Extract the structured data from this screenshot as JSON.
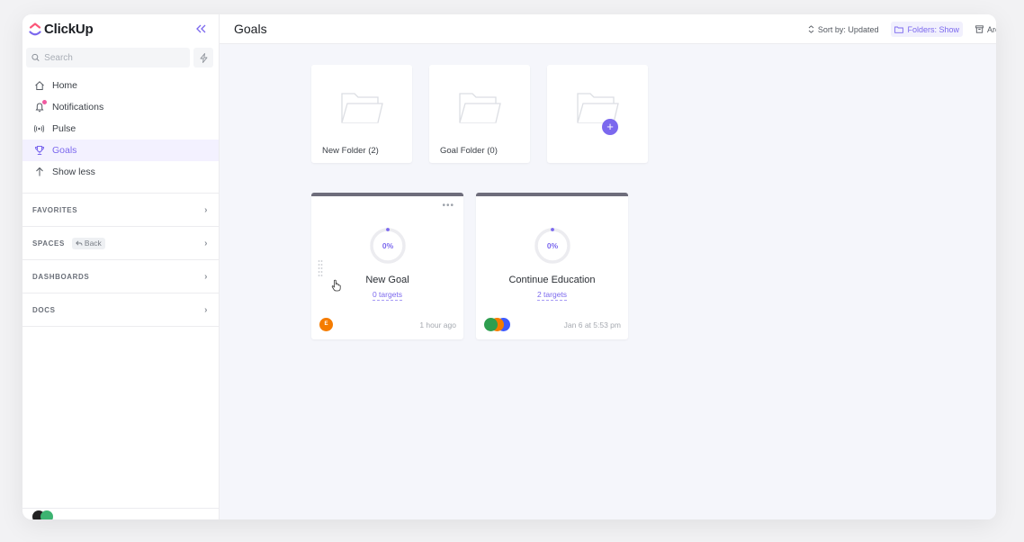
{
  "app": {
    "brand_name": "ClickUp",
    "accent_color": "#7b68ee"
  },
  "sidebar": {
    "search_placeholder": "Search",
    "nav": [
      {
        "label": "Home",
        "icon": "home-icon"
      },
      {
        "label": "Notifications",
        "icon": "bell-icon"
      },
      {
        "label": "Pulse",
        "icon": "pulse-icon"
      },
      {
        "label": "Goals",
        "icon": "trophy-icon",
        "active": true
      },
      {
        "label": "Show less",
        "icon": "arrow-up-icon"
      }
    ],
    "sections": [
      {
        "label": "FAVORITES"
      },
      {
        "label": "SPACES",
        "back_label": "Back"
      },
      {
        "label": "DASHBOARDS"
      },
      {
        "label": "DOCS"
      }
    ]
  },
  "header": {
    "title": "Goals",
    "sort_label": "Sort by: Updated",
    "folders_label": "Folders: Show",
    "archive_label": "Archived"
  },
  "folders": [
    {
      "label": "New Folder (2)"
    },
    {
      "label": "Goal Folder (0)"
    },
    {
      "label": "",
      "is_add": true
    }
  ],
  "goals": [
    {
      "name": "New Goal",
      "percent": "0%",
      "progress": 0,
      "targets": "0 targets",
      "updated": "1 hour ago",
      "avatar_initial": "E",
      "avatar_color": "#f57c00"
    },
    {
      "name": "Continue Education",
      "percent": "0%",
      "progress": 0,
      "targets": "2 targets",
      "updated": "Jan 6 at 5:53 pm",
      "avatar_colors": [
        "#2e9e4f",
        "#f57c00",
        "#3d5afe"
      ]
    }
  ]
}
